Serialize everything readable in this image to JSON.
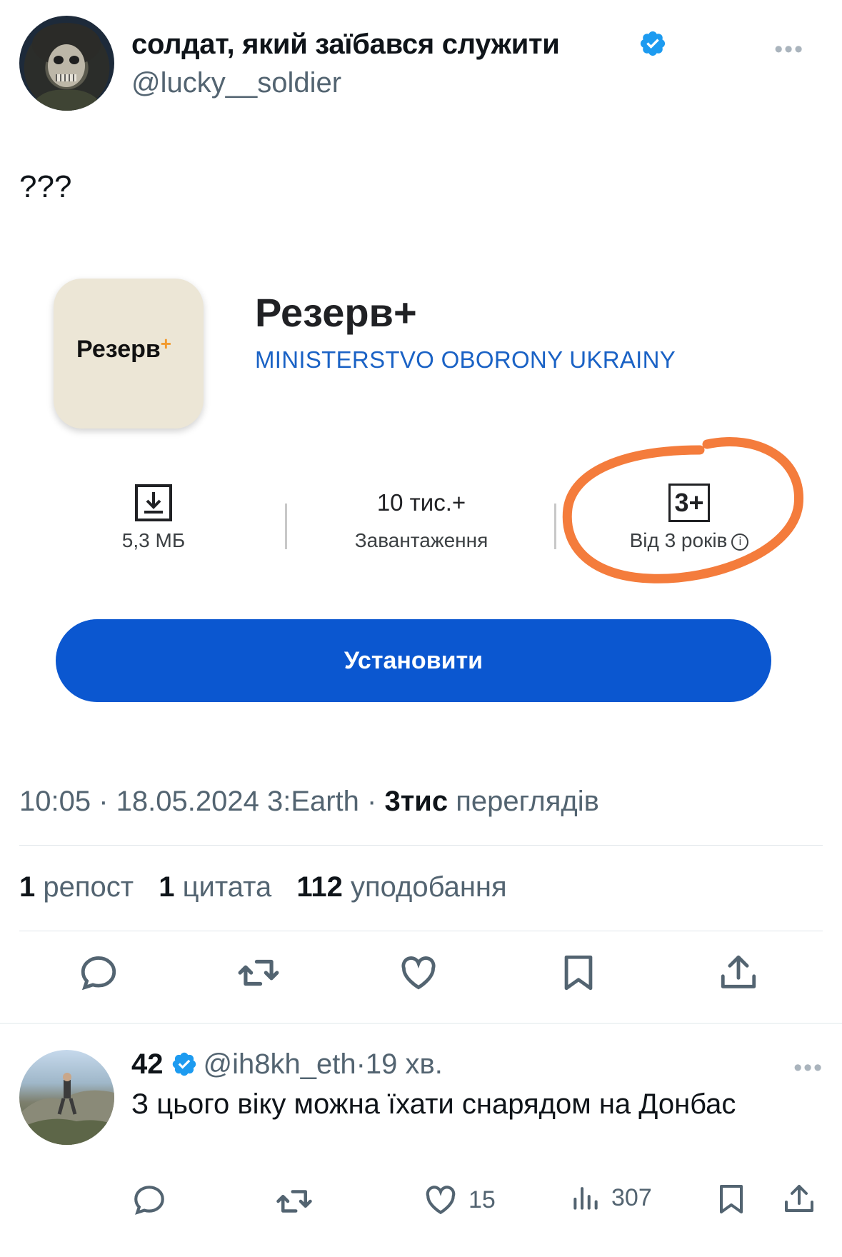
{
  "tweet": {
    "author_name": "солдат, який заїбався служити",
    "author_handle": "@lucky__soldier",
    "text": "???",
    "timestamp": "10:05 · 18.05.2024 3:Earth · ",
    "views_count": "3тис",
    "views_label": " переглядів",
    "reposts_count": "1",
    "reposts_label": "репост",
    "quotes_count": "1",
    "quotes_label": "цитата",
    "likes_count": "112",
    "likes_label": "уподобання"
  },
  "app_card": {
    "icon_text": "Резерв",
    "icon_plus": "+",
    "title": "Резерв+",
    "developer": "MINISTERSTVO OBORONY UKRAINY",
    "size_value": "5,3 МБ",
    "downloads_value": "10 тис.+",
    "downloads_label": "Завантаження",
    "age_badge": "3+",
    "age_label": "Від 3 років",
    "install_label": "Установити",
    "annotation_color": "#f47c3c",
    "install_color": "#0b57d0"
  },
  "reply": {
    "name": "42",
    "handle": "@ih8kh_eth",
    "separator": "·",
    "time": "19 хв.",
    "text": "З цього віку можна їхати снарядом на Донбас",
    "likes": "15",
    "views": "307"
  },
  "icons": {
    "verified": "verified-badge-icon",
    "more": "more-icon",
    "reply": "reply-icon",
    "retweet": "retweet-icon",
    "like": "heart-icon",
    "bookmark": "bookmark-icon",
    "share": "share-icon",
    "views": "views-icon",
    "download": "download-icon",
    "info": "info-icon"
  },
  "colors": {
    "verified": "#1d9bf0",
    "secondary_text": "#536471"
  }
}
